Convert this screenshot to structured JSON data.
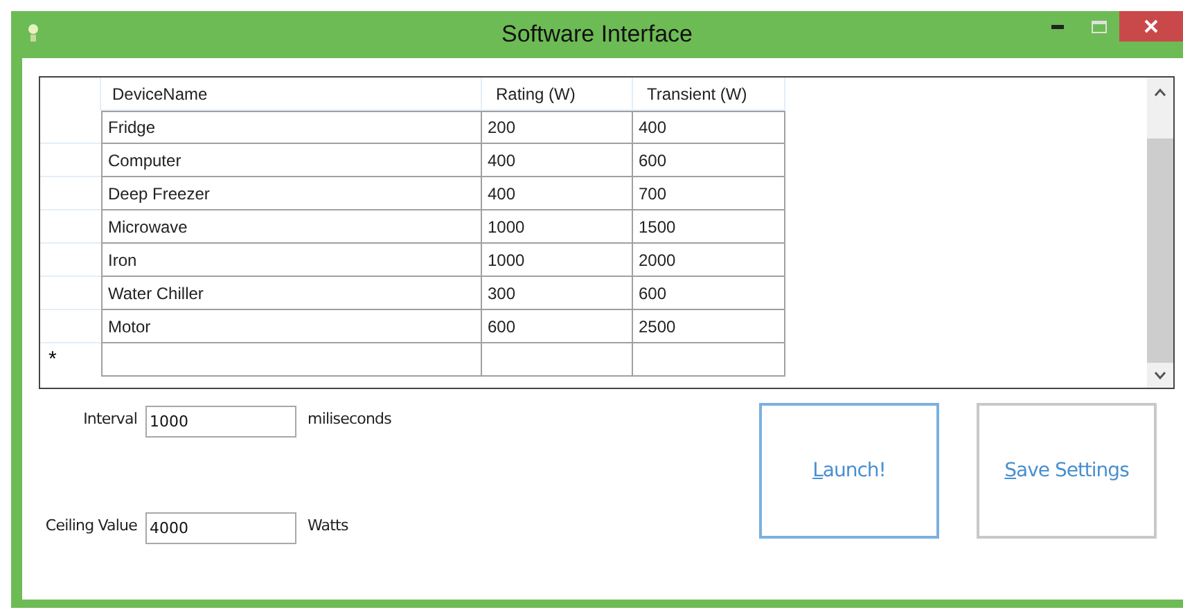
{
  "window": {
    "title": "Software Interface"
  },
  "table": {
    "columns": [
      "DeviceName",
      "Rating (W)",
      "Transient (W)"
    ],
    "rows": [
      [
        "Fridge",
        "200",
        "400"
      ],
      [
        "Computer",
        "400",
        "600"
      ],
      [
        "Deep Freezer",
        "400",
        "700"
      ],
      [
        "Microwave",
        "1000",
        "1500"
      ],
      [
        "Iron",
        "1000",
        "2000"
      ],
      [
        "Water Chiller",
        "300",
        "600"
      ],
      [
        "Motor",
        "600",
        "2500"
      ]
    ],
    "new_row_marker": "*"
  },
  "fields": [
    {
      "label": "Interval",
      "value": "1000",
      "unit": "miliseconds"
    },
    {
      "label": "Ceiling Value",
      "value": "4000",
      "unit": "Watts"
    }
  ],
  "buttons": [
    {
      "label": "Launch!",
      "focused": true
    },
    {
      "label": "Save Settings",
      "focused": false
    }
  ]
}
